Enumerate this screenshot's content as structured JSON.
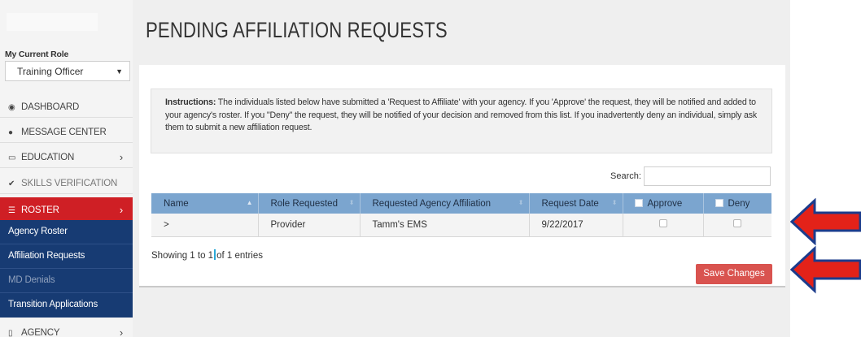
{
  "sidebar": {
    "role_label": "My Current Role",
    "role_value": "Training Officer",
    "nav": {
      "dashboard": "DASHBOARD",
      "message_center": "MESSAGE CENTER",
      "education": "EDUCATION",
      "skills_verification": "SKILLS VERIFICATION",
      "roster": "ROSTER",
      "agency": "AGENCY"
    },
    "roster_sub": {
      "agency_roster": "Agency Roster",
      "affiliation_requests": "Affiliation Requests",
      "md_denials": "MD Denials",
      "transition_applications": "Transition Applications"
    }
  },
  "page": {
    "title": "PENDING AFFILIATION REQUESTS",
    "instructions_lead": "Instructions:",
    "instructions_body": " The individuals listed below have submitted a 'Request to Affiliate' with your agency. If you 'Approve' the request, they will be notified and added to your agency's roster. If you \"Deny\" the request, they will be notified of your decision and removed from this list. If you inadvertently deny an individual, simply ask them to submit a new affiliation request.",
    "search_label": "Search:",
    "search_value": "",
    "showing_prefix": "Showing 1 to 1",
    "showing_suffix": "of 1 entries",
    "save_label": "Save Changes"
  },
  "table": {
    "headers": {
      "name": "Name",
      "role": "Role Requested",
      "agency": "Requested Agency Affiliation",
      "date": "Request Date",
      "approve": "Approve",
      "deny": "Deny"
    },
    "rows": [
      {
        "expander": ">",
        "name": "",
        "role": "Provider",
        "agency": "Tamm's EMS",
        "date": "9/22/2017",
        "approve": false,
        "deny": false
      }
    ]
  },
  "colors": {
    "active_nav": "#cf1f25",
    "subnav_bg": "#173b73",
    "table_header": "#7ba5cf",
    "save_button": "#d9534f",
    "annotation_arrow": "#e32219"
  }
}
